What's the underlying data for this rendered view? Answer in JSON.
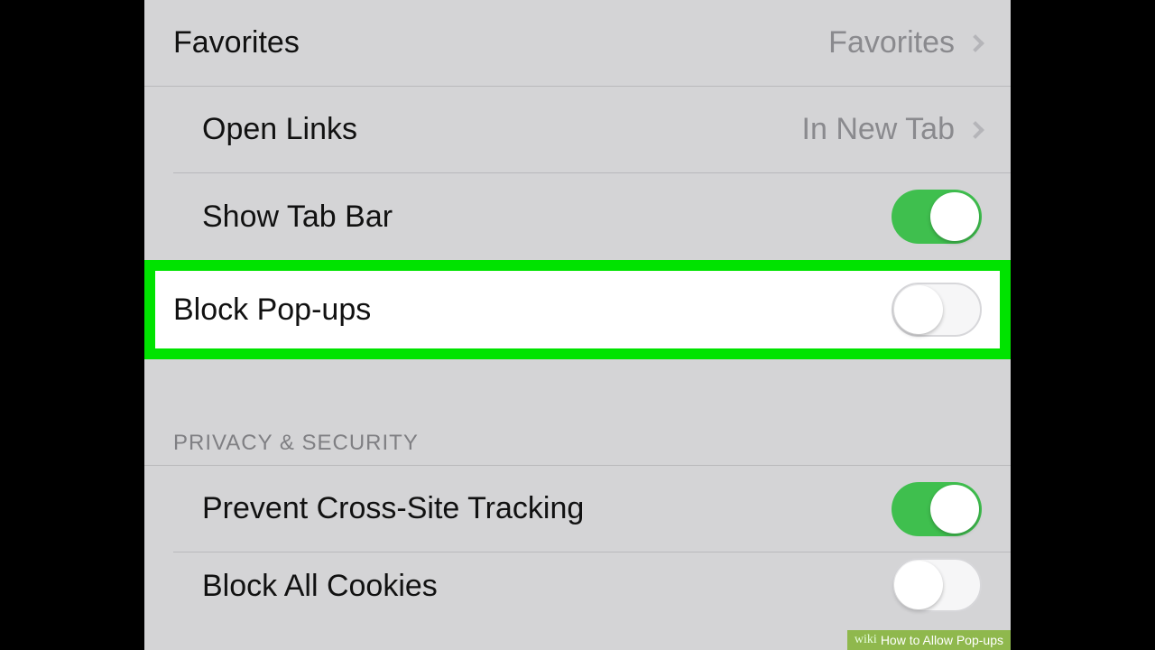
{
  "settings": {
    "favorites": {
      "label": "Favorites",
      "value": "Favorites"
    },
    "open_links": {
      "label": "Open Links",
      "value": "In New Tab"
    },
    "show_tab_bar": {
      "label": "Show Tab Bar",
      "on": true
    },
    "block_popups": {
      "label": "Block Pop-ups",
      "on": false
    }
  },
  "section_privacy": {
    "header": "PRIVACY & SECURITY",
    "prevent_cross_site": {
      "label": "Prevent Cross-Site Tracking",
      "on": true
    },
    "block_all_cookies": {
      "label": "Block All Cookies",
      "on": false
    }
  },
  "watermark": {
    "brand": "wiki",
    "title": "How to Allow Pop-ups"
  }
}
